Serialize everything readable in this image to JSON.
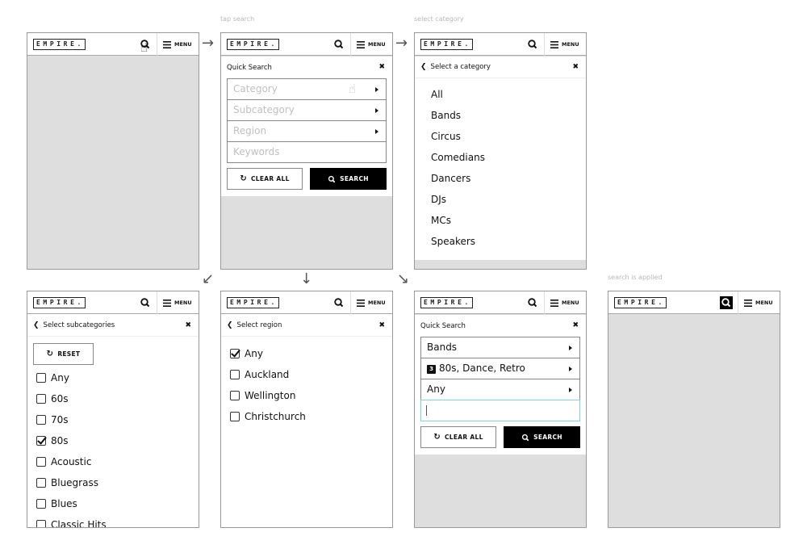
{
  "captions": {
    "tap_search": "tap search",
    "select_category": "select category",
    "search_applied": "search is applied"
  },
  "brand": {
    "logo": "EMPIRE.",
    "menu_label": "MENU"
  },
  "icons": {
    "search": "search-icon",
    "menu": "hamburger-icon",
    "close": "close-icon",
    "back": "chevron-left-icon",
    "reset": "undo-icon",
    "pointer": "hand-pointer-icon",
    "flow_arrows": [
      "arrow-right-icon",
      "arrow-right-icon",
      "arrow-down-left-icon",
      "arrow-down-icon",
      "arrow-down-right-icon"
    ]
  },
  "glyphs": {
    "back": "❮",
    "close": "✖",
    "hand": "☝",
    "arrow_right": "→",
    "arrow_down": "↓",
    "arrow_down_left": "↙",
    "arrow_down_right": "↘",
    "reset": "↻"
  },
  "quick_search": {
    "title": "Quick Search",
    "category_placeholder": "Category",
    "subcategory_placeholder": "Subcategory",
    "region_placeholder": "Region",
    "keywords_placeholder": "Keywords",
    "clear_label": "CLEAR ALL",
    "search_label": "SEARCH"
  },
  "category_screen": {
    "title": "Select a category",
    "items": [
      "All",
      "Bands",
      "Circus",
      "Comedians",
      "Dancers",
      "DJs",
      "MCs",
      "Speakers"
    ]
  },
  "subcategory_screen": {
    "title": "Select subcategories",
    "reset_label": "RESET",
    "items": [
      {
        "label": "Any",
        "checked": false
      },
      {
        "label": "60s",
        "checked": false
      },
      {
        "label": "70s",
        "checked": false
      },
      {
        "label": "80s",
        "checked": true
      },
      {
        "label": "Acoustic",
        "checked": false
      },
      {
        "label": "Bluegrass",
        "checked": false
      },
      {
        "label": "Blues",
        "checked": false
      },
      {
        "label": "Classic Hits",
        "checked": false
      }
    ]
  },
  "region_screen": {
    "title": "Select region",
    "items": [
      {
        "label": "Any",
        "checked": true
      },
      {
        "label": "Auckland",
        "checked": false
      },
      {
        "label": "Wellington",
        "checked": false
      },
      {
        "label": "Christchurch",
        "checked": false
      }
    ]
  },
  "filled_search": {
    "title": "Quick Search",
    "category_value": "Bands",
    "subcategory_count": "3",
    "subcategory_value": "80s, Dance, Retro",
    "region_value": "Any",
    "keywords_value": "",
    "clear_label": "CLEAR ALL",
    "search_label": "SEARCH"
  }
}
